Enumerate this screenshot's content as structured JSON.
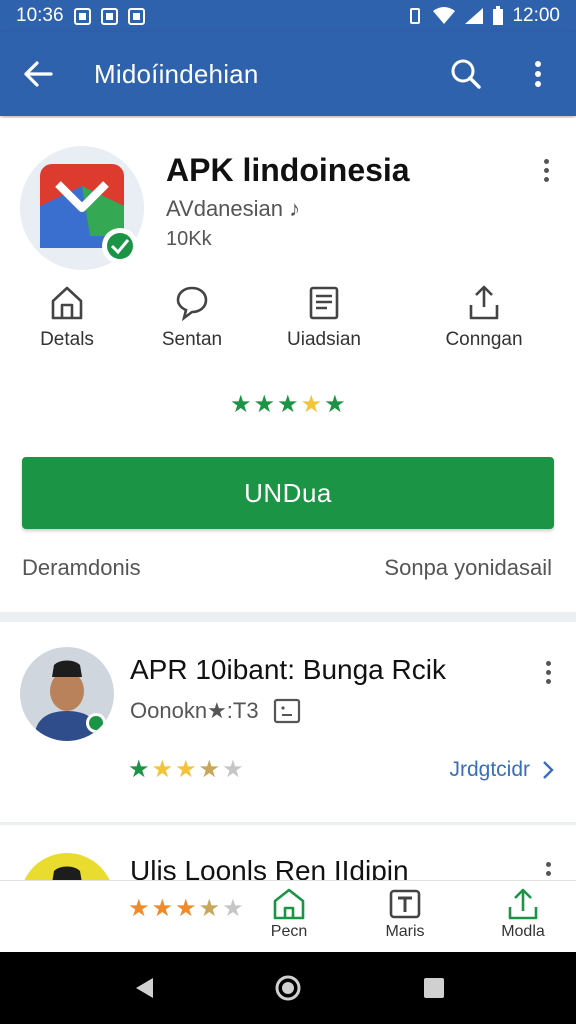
{
  "status_bar": {
    "time_left": "10:36",
    "time_right": "12:00"
  },
  "app_bar": {
    "title": "Midoíindehian",
    "search_icon": "search-icon",
    "more_icon": "more-vert-icon",
    "back_icon": "arrow-back-icon"
  },
  "app": {
    "name": "APK lindoinesia",
    "developer": "AVdanesian ♪",
    "size": "10Kk",
    "rating_stars": 4.5,
    "tabs": [
      {
        "label": "Detals",
        "icon": "home-icon"
      },
      {
        "label": "Sentan",
        "icon": "chat-bubble-icon"
      },
      {
        "label": "Uiadsian",
        "icon": "document-icon"
      },
      {
        "label": "Conngan",
        "icon": "share-icon"
      }
    ],
    "install_label": "UNDua",
    "link_left": "Deramdonis",
    "link_right": "Sonpa yonidasail"
  },
  "list": [
    {
      "title": "APR 10ibant: Bunga Rcik",
      "subtitle": "Oonokn★:T3",
      "link": "Jrdgtcidr",
      "rating": 4
    },
    {
      "title": "Ulis Loonls Ren IIdipin",
      "rating": 3.5
    }
  ],
  "bottom_nav": [
    {
      "label": "Pecn",
      "icon": "home-outline-icon"
    },
    {
      "label": "Maris",
      "icon": "text-box-icon"
    },
    {
      "label": "Modla",
      "icon": "upload-icon"
    }
  ],
  "colors": {
    "primary": "#2f62ad",
    "install": "#1b9445",
    "star_green": "#1b9445",
    "star_gold": "#f3c339",
    "star_orange": "#f08a2a"
  }
}
